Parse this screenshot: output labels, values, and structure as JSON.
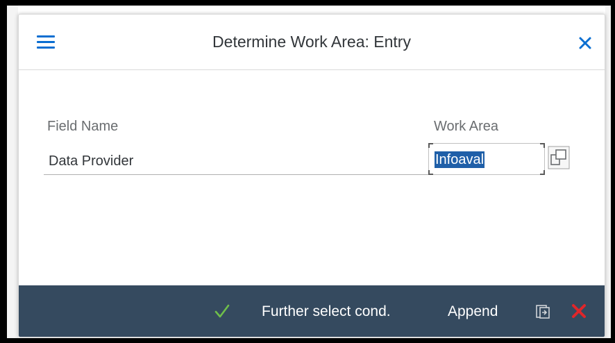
{
  "dialog": {
    "title": "Determine Work Area: Entry"
  },
  "form": {
    "field_name_label": "Field Name",
    "work_area_label": "Work Area",
    "row": {
      "field_name": "Data Provider",
      "work_area_value": "Infoaval"
    }
  },
  "footer": {
    "further_select_label": "Further select cond.",
    "append_label": "Append"
  },
  "icons": {
    "menu": "hamburger-menu-icon",
    "close": "close-icon",
    "value_help": "value-help-icon",
    "ok": "checkmark-icon",
    "transfer": "transfer-icon",
    "cancel": "cancel-x-icon"
  },
  "colors": {
    "accent": "#0a6ed1",
    "footer_bg": "#354a5f",
    "ok_green": "#6fbf4a",
    "cancel_red": "#e0262a",
    "selection": "#1f5fa8"
  }
}
